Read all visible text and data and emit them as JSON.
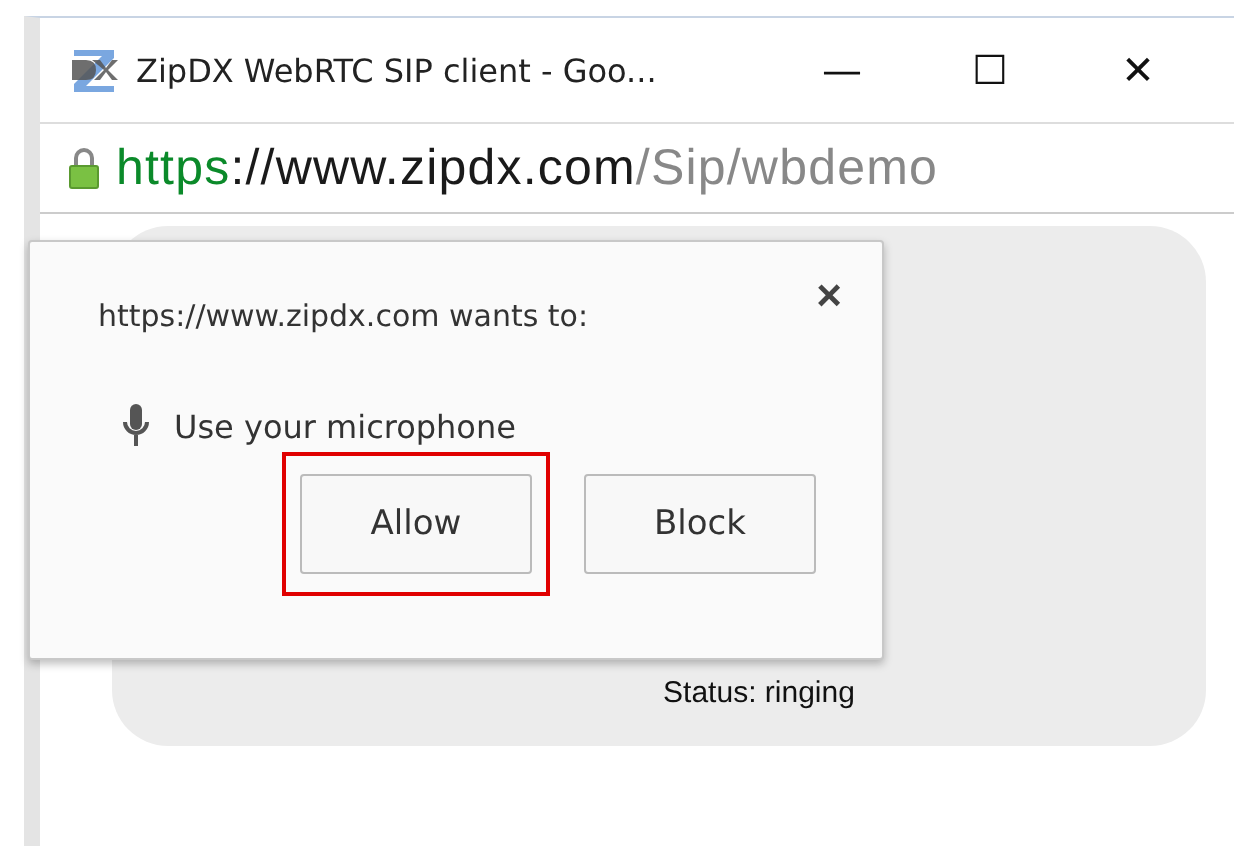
{
  "window": {
    "title": "ZipDX WebRTC SIP client - Goo...",
    "controls": [
      "—",
      "☐",
      "✕"
    ]
  },
  "address_bar": {
    "secure": true,
    "scheme": "https",
    "host": "://www.zipdx.com",
    "path": "/Sip/wbdemo"
  },
  "permission_popup": {
    "heading": "https://www.zipdx.com wants to:",
    "close": "×",
    "permission": "Use your microphone",
    "buttons": [
      {
        "label": "Allow",
        "highlighted": true
      },
      {
        "label": "Block",
        "highlighted": false
      }
    ]
  },
  "page": {
    "status": "Status: ringing"
  }
}
